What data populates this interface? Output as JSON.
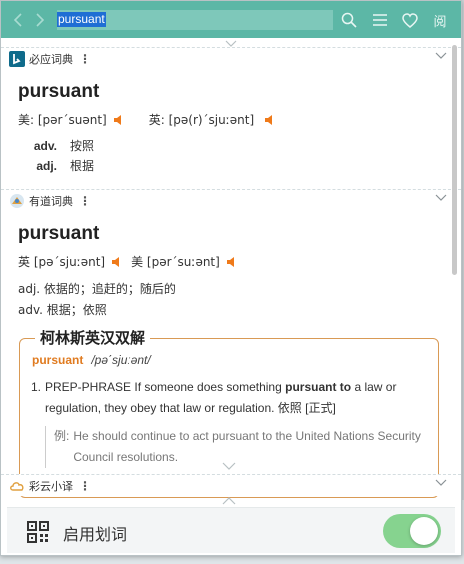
{
  "toolbar": {
    "back_icon": "chevron-left-icon",
    "forward_icon": "chevron-right-icon",
    "search_value": "pursuant",
    "icons": [
      "search-icon",
      "menu-icon",
      "heart-icon",
      "reader-icon"
    ],
    "reader_glyph": "阅",
    "accent": "#5cb7a6"
  },
  "bing": {
    "name": "必应词典",
    "more": "⋮",
    "word": "pursuant",
    "us_label": "美: [pər΄suənt]",
    "uk_label": "英: [pə(r)΄sjuːənt]",
    "defs": [
      {
        "pos": "adv.",
        "meaning": "按照"
      },
      {
        "pos": "adj.",
        "meaning": "根据"
      }
    ]
  },
  "youdao": {
    "name": "有道词典",
    "more": "⋮",
    "word": "pursuant",
    "uk_label": "英 [pə΄sjuːənt]",
    "us_label": "美 [pər΄suːənt]",
    "defs": [
      "adj. 依据的；追赶的；随后的",
      "adv. 根据；依照"
    ]
  },
  "collins": {
    "title": "柯林斯英汉双解",
    "word": "pursuant",
    "phonetic": "/pə΄sjuːənt/",
    "sense_num": "1.",
    "sense_a": "PREP-PHRASE If someone does something ",
    "sense_bold": "pursuant to",
    "sense_b": " a law or regulation, they obey that law or regulation. 依照 [正式]",
    "example_label": "例:",
    "example": "He should continue to act pursuant to the United Nations Security Council resolutions."
  },
  "caiyun": {
    "name": "彩云小译",
    "more": "⋮"
  },
  "footer": {
    "label": "启用划词",
    "toggle_on": true,
    "toggle_color": "#86d38f"
  }
}
